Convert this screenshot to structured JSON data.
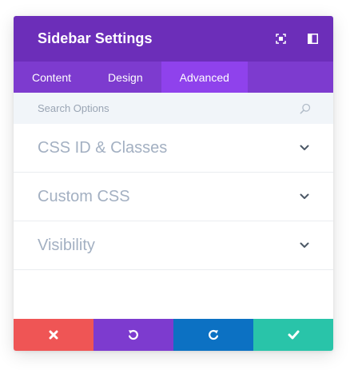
{
  "modal": {
    "title": "Sidebar Settings",
    "header_icons": [
      "expand-icon",
      "sidebar-toggle-icon"
    ]
  },
  "tabs": [
    {
      "label": "Content",
      "active": false
    },
    {
      "label": "Design",
      "active": false
    },
    {
      "label": "Advanced",
      "active": true
    }
  ],
  "search": {
    "placeholder": "Search Options",
    "value": ""
  },
  "sections": [
    {
      "label": "CSS ID & Classes"
    },
    {
      "label": "Custom CSS"
    },
    {
      "label": "Visibility"
    }
  ],
  "footer": {
    "buttons": [
      {
        "name": "discard",
        "icon": "close-icon",
        "color": "#ef5555"
      },
      {
        "name": "undo",
        "icon": "undo-icon",
        "color": "#7d3bcf"
      },
      {
        "name": "redo",
        "icon": "redo-icon",
        "color": "#0c71c3"
      },
      {
        "name": "save",
        "icon": "check-icon",
        "color": "#29c4a9"
      }
    ]
  },
  "colors": {
    "header": "#6c2eb9",
    "tabs": "#7d3bcf",
    "active_tab": "#8f42ec",
    "section_text": "#a3b0c2",
    "chevron": "#4c5866"
  }
}
